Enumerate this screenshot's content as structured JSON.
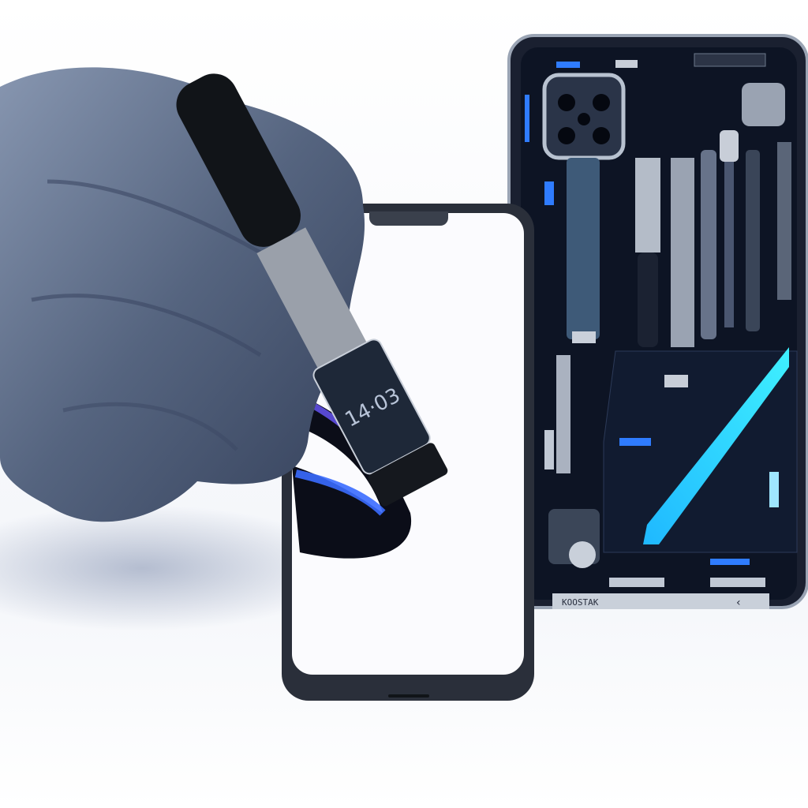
{
  "scene": {
    "tool_display_time": "14·03",
    "open_phone_label": "KOOSTAK",
    "colors": {
      "glove": "#5a6a86",
      "phone_frame": "#2a2f3a",
      "screen": "#fbfbfe",
      "circuit_board": "#0d1424",
      "cyan_accent": "#20d8ff",
      "blue_glow": "#3a5cff"
    },
    "icons": [
      "camera-module-icon",
      "back-chevron-icon"
    ]
  }
}
